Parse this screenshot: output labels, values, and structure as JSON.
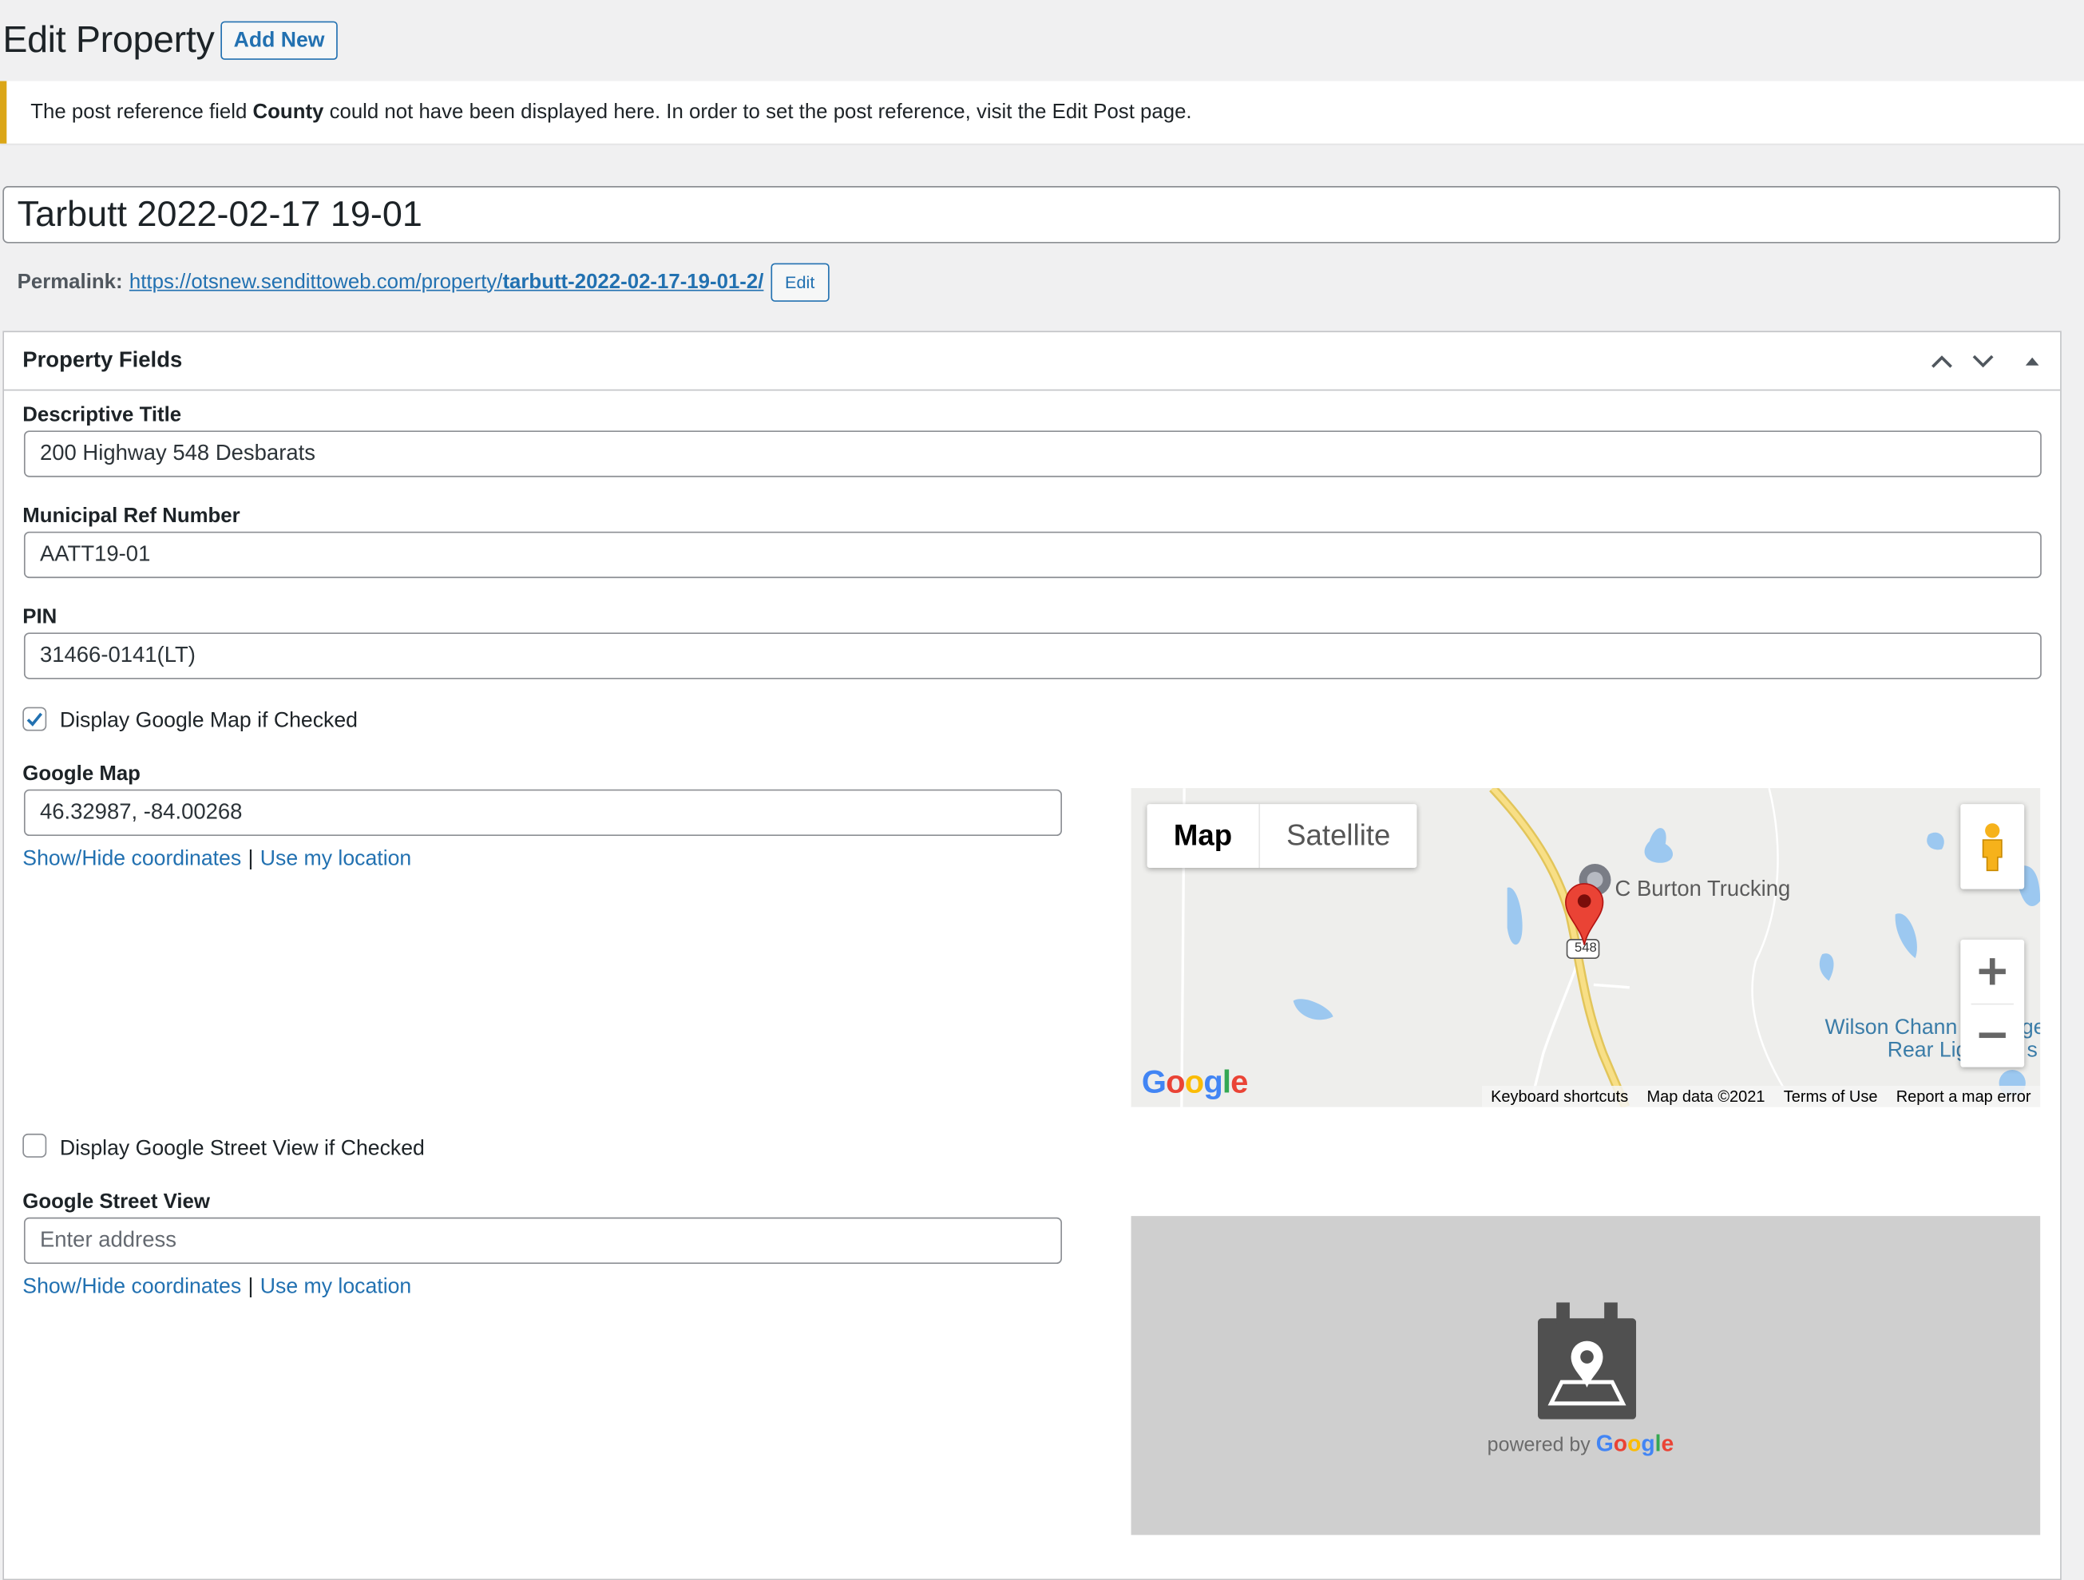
{
  "header": {
    "title": "Edit Property",
    "add_new_label": "Add New"
  },
  "notice": {
    "prefix": "The post reference field ",
    "field_name": "County",
    "suffix": " could not have been displayed here. In order to set the post reference, visit the Edit Post page."
  },
  "post": {
    "title": "Tarbutt 2022-02-17 19-01",
    "permalink_label": "Permalink:",
    "permalink_base": "https://otsnew.sendittoweb.com/property/",
    "permalink_slug": "tarbutt-2022-02-17-19-01-2/",
    "permalink_edit_label": "Edit"
  },
  "metabox": {
    "title": "Property Fields",
    "fields": {
      "descriptive_title": {
        "label": "Descriptive Title",
        "value": "200 Highway 548 Desbarats"
      },
      "municipal_ref": {
        "label": "Municipal Ref Number",
        "value": "AATT19-01"
      },
      "pin": {
        "label": "PIN",
        "value": "31466-0141(LT)"
      },
      "display_map": {
        "label": "Display Google Map if Checked",
        "checked": true
      },
      "google_map": {
        "label": "Google Map",
        "value": "46.32987, -84.00268",
        "show_hide_label": "Show/Hide coordinates",
        "separator": "|",
        "use_location_label": "Use my location"
      },
      "display_street_view": {
        "label": "Display Google Street View if Checked",
        "checked": false
      },
      "google_street_view": {
        "label": "Google Street View",
        "placeholder": "Enter address",
        "show_hide_label": "Show/Hide coordinates",
        "separator": "|",
        "use_location_label": "Use my location"
      }
    }
  },
  "map": {
    "type_map_label": "Map",
    "type_satellite_label": "Satellite",
    "place_label": "C Burton Trucking",
    "route_shield": "548",
    "water_label_1": "Wilson Chann",
    "water_label_2": "Rear Lig",
    "water_label_3": "ge",
    "water_label_4": "s",
    "google_logo": "Google",
    "footer": {
      "keyboard": "Keyboard shortcuts",
      "map_data": "Map data ©2021",
      "terms": "Terms of Use",
      "report": "Report a map error"
    }
  },
  "street_view": {
    "powered_by": "powered by",
    "google_logo": "Google"
  },
  "colors": {
    "wp_blue": "#2271b1",
    "notice_warning": "#dba617",
    "map_water": "#9cc8f0",
    "map_road": "#f5d56b",
    "marker_red": "#ea4335"
  }
}
